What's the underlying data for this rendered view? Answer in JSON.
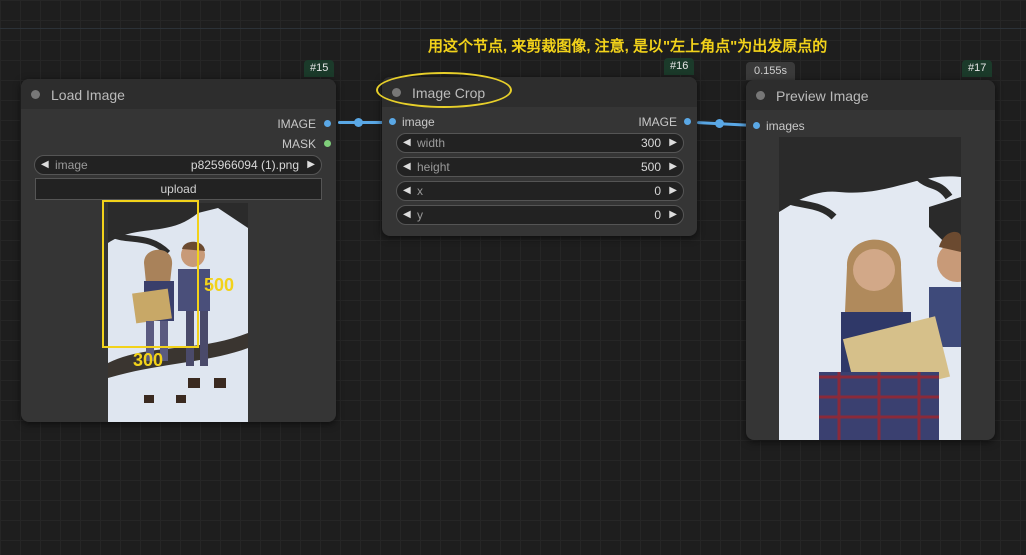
{
  "annotation": "用这个节点, 来剪裁图像, 注意, 是以\"左上角点\"为出发原点的",
  "colors": {
    "accent_wire": "#5aa8e6",
    "annotation": "#f2d21a",
    "mask_port": "#7fcf7a"
  },
  "load_image": {
    "id": "#15",
    "title": "Load Image",
    "outputs": [
      "IMAGE",
      "MASK"
    ],
    "image_widget": {
      "label": "image",
      "value": "p825966094 (1).png"
    },
    "upload_label": "upload",
    "crop_labels": {
      "height": "500",
      "width": "300"
    }
  },
  "image_crop": {
    "id": "#16",
    "title": "Image Crop",
    "input": "image",
    "output": "IMAGE",
    "params": [
      {
        "label": "width",
        "value": "300"
      },
      {
        "label": "height",
        "value": "500"
      },
      {
        "label": "x",
        "value": "0"
      },
      {
        "label": "y",
        "value": "0"
      }
    ]
  },
  "preview_image": {
    "id": "#17",
    "timing": "0.155s",
    "title": "Preview Image",
    "input": "images"
  }
}
